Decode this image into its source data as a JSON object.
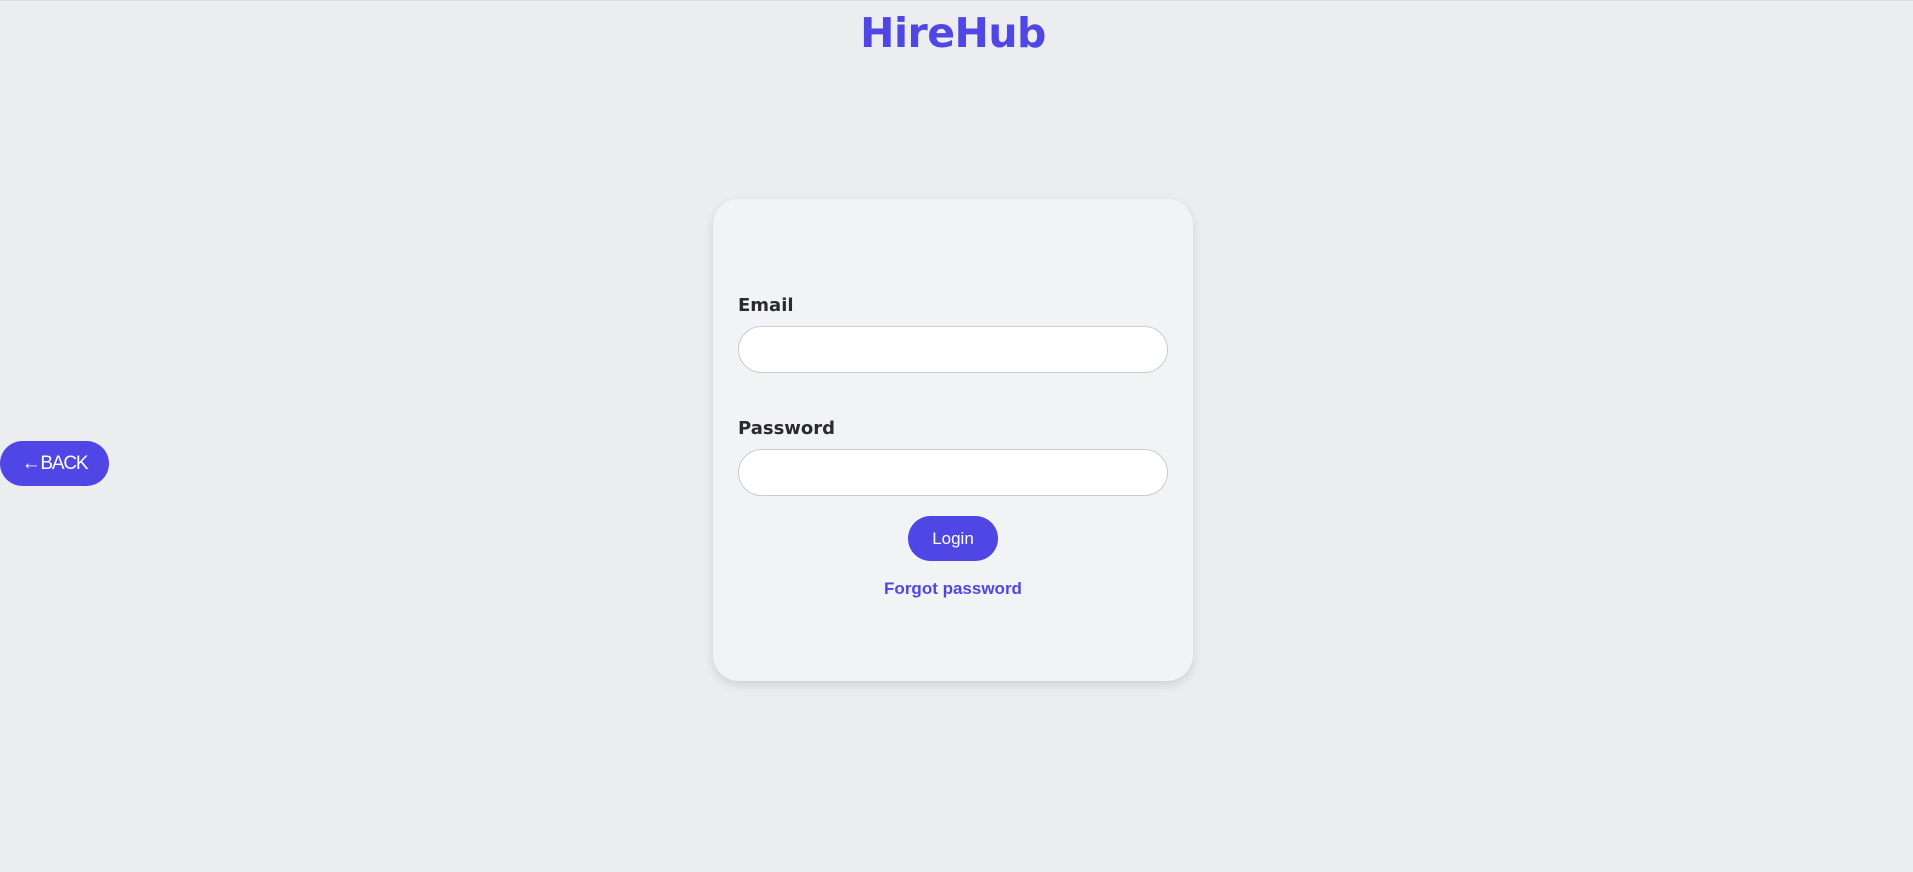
{
  "header": {
    "brand": "HireHub"
  },
  "nav": {
    "back_label": "BACK",
    "back_icon": "arrow-left-icon",
    "back_arrow_glyph": "←"
  },
  "login_form": {
    "email_label": "Email",
    "email_value": "",
    "email_placeholder": "",
    "password_label": "Password",
    "password_value": "",
    "password_placeholder": "",
    "login_label": "Login",
    "forgot_label": "Forgot password"
  },
  "colors": {
    "accent": "#4f46e5",
    "background": "#ecedef",
    "card": "#f2f3f5",
    "label_text": "#2b2b2b"
  }
}
